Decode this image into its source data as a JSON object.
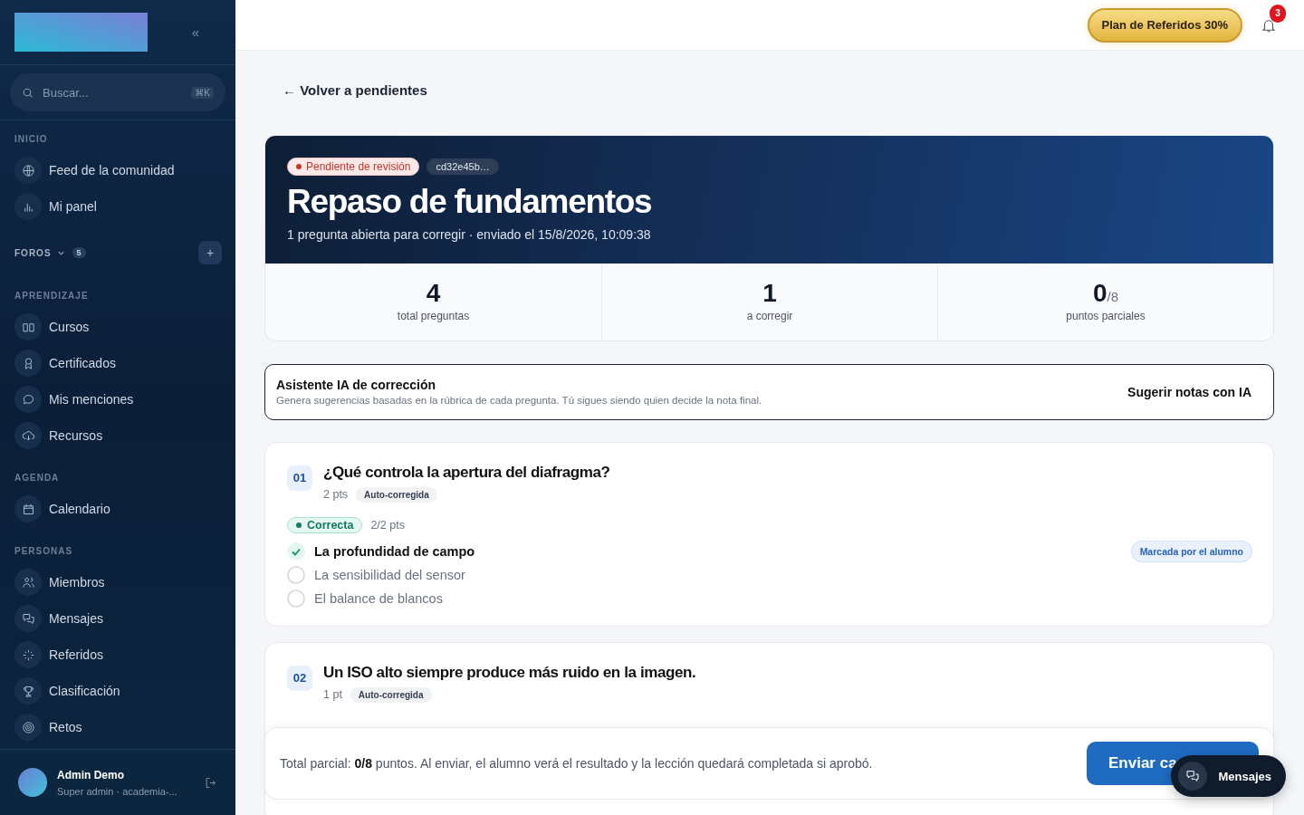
{
  "sidebar": {
    "collapse_button": "«",
    "search": {
      "placeholder": "Buscar...",
      "shortcut": "⌘K"
    },
    "sections": [
      {
        "kind": "list",
        "label": "INICIO",
        "items": [
          {
            "label": "Feed de la comunidad"
          },
          {
            "label": "Mi panel"
          }
        ]
      },
      {
        "kind": "group",
        "label": "FOROS",
        "count": "5",
        "expanded": true,
        "add_button": "+"
      },
      {
        "kind": "list",
        "label": "APRENDIZAJE",
        "items": [
          {
            "label": "Cursos"
          },
          {
            "label": "Certificados"
          },
          {
            "label": "Mis menciones"
          },
          {
            "label": "Recursos"
          }
        ]
      },
      {
        "kind": "list",
        "label": "AGENDA",
        "items": [
          {
            "label": "Calendario"
          }
        ]
      },
      {
        "kind": "list",
        "label": "PERSONAS",
        "items": [
          {
            "label": "Miembros"
          },
          {
            "label": "Mensajes"
          },
          {
            "label": "Referidos"
          },
          {
            "label": "Clasificación"
          },
          {
            "label": "Retos"
          }
        ]
      }
    ],
    "user": {
      "name": "Admin Demo",
      "role": "Super admin · academia-..."
    }
  },
  "topbar": {
    "promo_button": "Plan de Referidos 30%",
    "notifications_count": "3"
  },
  "back_link": "← Volver a pendientes",
  "header": {
    "status_badge": "Pendiente de revisión",
    "id_badge": "cd32e45b…",
    "title": "Repaso de fundamentos",
    "subtitle": "1 pregunta abierta para corregir · enviado el 15/8/2026, 10:09:38"
  },
  "stats": [
    {
      "value": "4",
      "label": "total preguntas"
    },
    {
      "value": "1",
      "label": "a corregir"
    },
    {
      "value": "0",
      "suffix": "/8",
      "label": "puntos parciales"
    }
  ],
  "ai_assistant": {
    "title": "Asistente IA de corrección",
    "description": "Genera sugerencias basadas en la rúbrica de cada pregunta. Tú sigues siendo quien decide la nota final.",
    "button": "Sugerir notas con IA"
  },
  "questions": [
    {
      "number": "01",
      "title": "¿Qué controla la apertura del diafragma?",
      "points": "2 pts",
      "type_badge": "Auto-corregida",
      "result": {
        "kind": "correct",
        "label": "Correcta",
        "score": "2/2 pts"
      },
      "options": [
        {
          "text": "La profundidad de campo",
          "selected": true,
          "tag": "Marcada por el alumno"
        },
        {
          "text": "La sensibilidad del sensor",
          "selected": false
        },
        {
          "text": "El balance de blancos",
          "selected": false
        }
      ]
    },
    {
      "number": "02",
      "title": "Un ISO alto siempre produce más ruido en la imagen.",
      "points": "1 pt",
      "type_badge": "Auto-corregida"
    }
  ],
  "footer": {
    "summary": "Total parcial: **0/8** puntos. Al enviar, el alumno verá el resultado y la lección quedará completada si aprobó.",
    "submit_button": "Enviar ca"
  },
  "chat_button": "Mensajes"
}
